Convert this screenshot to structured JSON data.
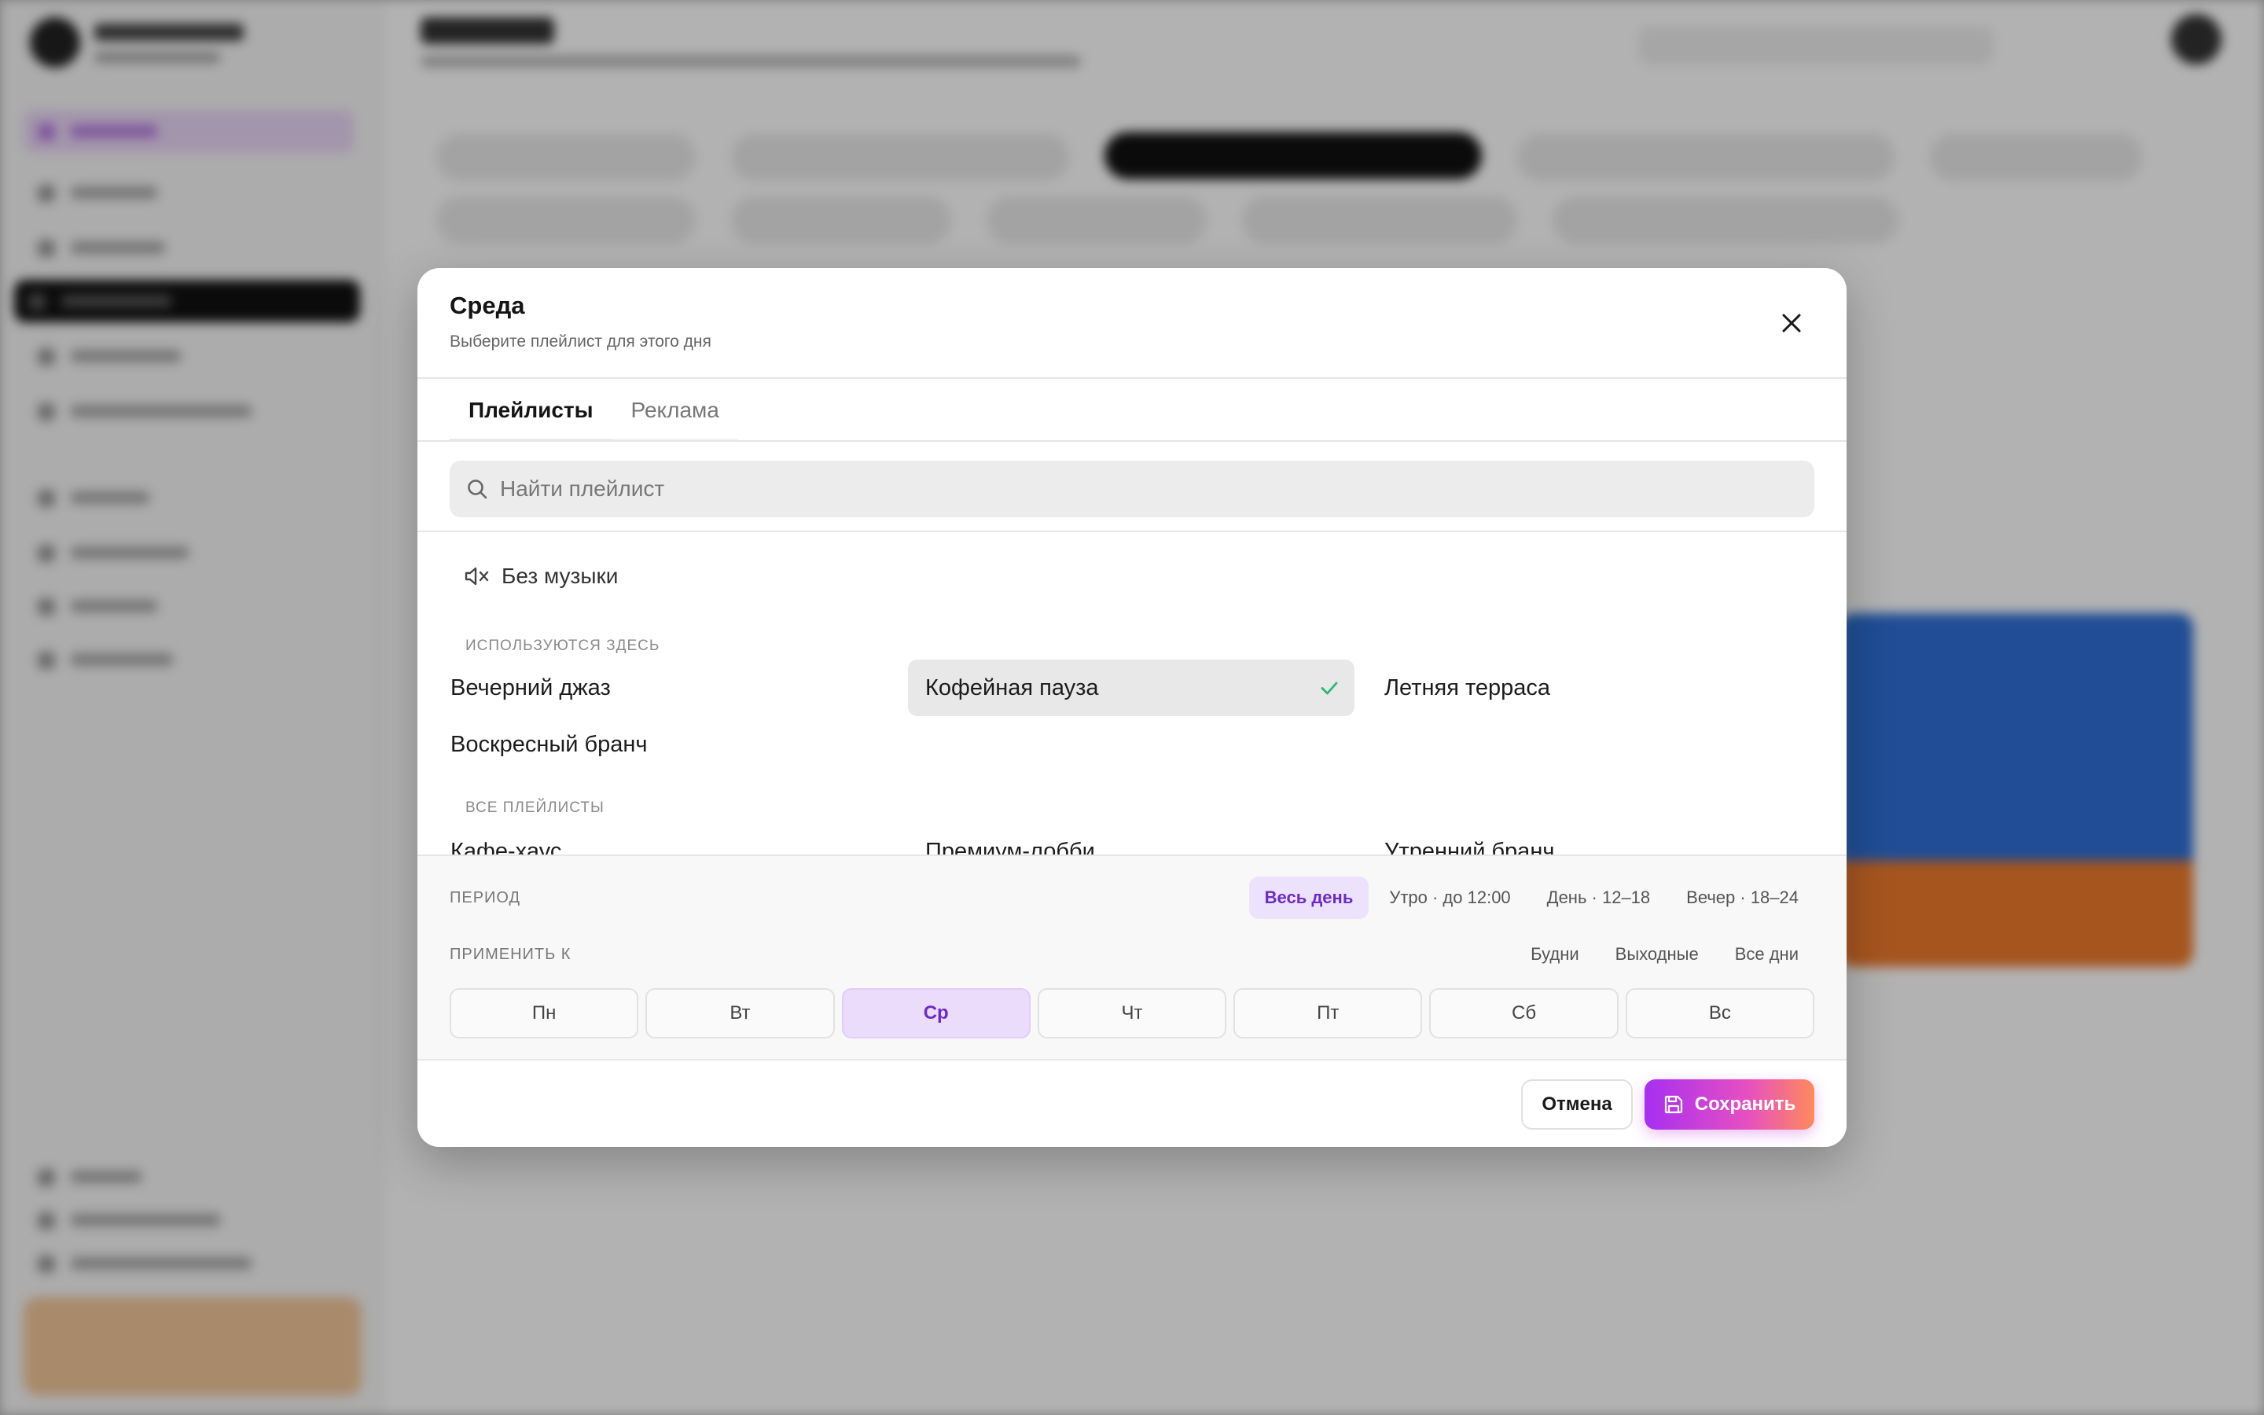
{
  "modal": {
    "title": "Среда",
    "subtitle": "Выберите плейлист для этого дня",
    "tabs": [
      {
        "label": "Плейлисты"
      },
      {
        "label": "Реклама"
      }
    ],
    "search_placeholder": "Найти плейлист",
    "no_music_label": "Без музыки",
    "sections": {
      "used_here": "Используются здесь",
      "all": "Все плейлисты"
    },
    "used_here_playlists": [
      "Вечерний джаз",
      "Кофейная пауза",
      "Летняя терраса",
      "Воскресный бранч"
    ],
    "selected_playlist": "Кофейная пауза",
    "all_playlists": [
      "Кафе-хаус",
      "Премиум-лобби",
      "Утренний бранч"
    ],
    "period": {
      "label": "Период",
      "options": [
        "Весь день",
        "Утро · до 12:00",
        "День · 12–18",
        "Вечер · 18–24"
      ],
      "selected": "Весь день"
    },
    "apply_to": {
      "label": "Применить к",
      "options": [
        "Будни",
        "Выходные",
        "Все дни"
      ],
      "days": [
        "Пн",
        "Вт",
        "Ср",
        "Чт",
        "Пт",
        "Сб",
        "Вс"
      ],
      "selected_day": "Ср"
    },
    "buttons": {
      "cancel": "Отмена",
      "save": "Сохранить"
    }
  },
  "icons": {
    "close": "close-icon",
    "search": "search-icon",
    "mute": "speaker-mute-icon",
    "check": "check-icon",
    "save": "floppy-disk-icon"
  },
  "colors": {
    "accent": "#6b2bc4",
    "accent_bg": "#ebdcfb",
    "check": "#2bb673",
    "save_gradient": [
      "#a72ff2",
      "#e64fc2",
      "#ff8a5c"
    ]
  }
}
